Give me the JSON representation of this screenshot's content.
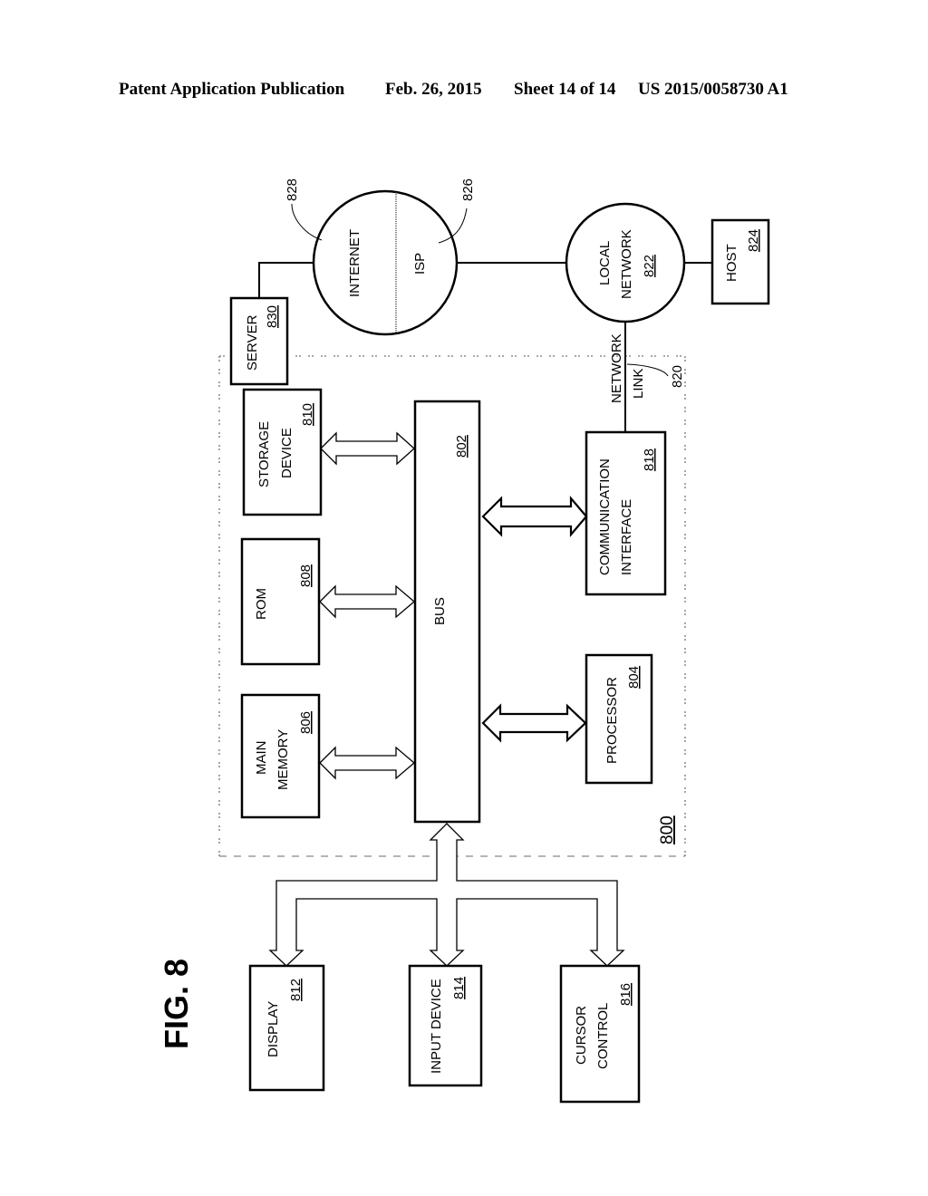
{
  "header": {
    "publication": "Patent Application Publication",
    "date": "Feb. 26, 2015",
    "sheet": "Sheet 14 of 14",
    "number": "US 2015/0058730 A1"
  },
  "figure": {
    "title": "FIG. 8",
    "system_ref": "800"
  },
  "blocks": {
    "main_memory": {
      "line1": "MAIN",
      "line2": "MEMORY",
      "ref": "806"
    },
    "rom": {
      "line1": "ROM",
      "ref": "808"
    },
    "storage": {
      "line1": "STORAGE",
      "line2": "DEVICE",
      "ref": "810"
    },
    "bus": {
      "label": "BUS",
      "ref": "802"
    },
    "processor": {
      "line1": "PROCESSOR",
      "ref": "804"
    },
    "comm": {
      "line1": "COMMUNICATION",
      "line2": "INTERFACE",
      "ref": "818"
    },
    "server": {
      "line1": "SERVER",
      "ref": "830"
    },
    "internet": {
      "label": "INTERNET",
      "ref": "828"
    },
    "isp": {
      "label": "ISP",
      "ref": "826"
    },
    "local_network": {
      "line1": "LOCAL",
      "line2": "NETWORK",
      "ref": "822"
    },
    "host": {
      "line1": "HOST",
      "ref": "824"
    },
    "network_link": {
      "line1": "NETWORK",
      "line2": "LINK",
      "ref": "820"
    },
    "display": {
      "line1": "DISPLAY",
      "ref": "812"
    },
    "input_device": {
      "line1": "INPUT DEVICE",
      "ref": "814"
    },
    "cursor_control": {
      "line1": "CURSOR",
      "line2": "CONTROL",
      "ref": "816"
    }
  }
}
